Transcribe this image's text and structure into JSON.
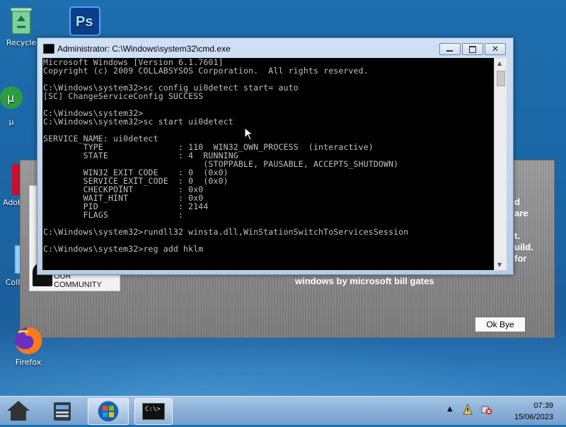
{
  "desktop": {
    "icons": [
      {
        "label": "Recycle",
        "icon": "recycle-bin-icon"
      },
      {
        "label": "",
        "icon": "photoshop-icon"
      },
      {
        "label": "Firefox",
        "icon": "firefox-icon"
      },
      {
        "label": "Adob",
        "icon": "adobe-icon"
      },
      {
        "label": "Coll",
        "icon": "collab-icon"
      },
      {
        "label": "µ",
        "icon": "utorrent-icon"
      }
    ]
  },
  "bg_dialog": {
    "right_text_1": "d",
    "right_text_2": "are",
    "right_text_3": "t.",
    "right_text_4": "uild.",
    "right_text_5": "for",
    "bottom_text": "windows by microsoft bill gates",
    "left_partial": "OUR COMMUNITY",
    "ok_button": "Ok Bye"
  },
  "cmd_window": {
    "title": "Administrator: C:\\Windows\\system32\\cmd.exe",
    "lines": [
      "Microsoft Windows [Version 6.1.7601]",
      "Copyright (c) 2009 COLLABSYSOS Corporation.  All rights reserved.",
      "",
      "C:\\Windows\\system32>sc config ui0detect start= auto",
      "[SC] ChangeServiceConfig SUCCESS",
      "",
      "C:\\Windows\\system32>",
      "C:\\Windows\\system32>sc start ui0detect",
      "",
      "SERVICE_NAME: ui0detect",
      "        TYPE               : 110  WIN32_OWN_PROCESS  (interactive)",
      "        STATE              : 4  RUNNING",
      "                                (STOPPABLE, PAUSABLE, ACCEPTS_SHUTDOWN)",
      "        WIN32_EXIT_CODE    : 0  (0x0)",
      "        SERVICE_EXIT_CODE  : 0  (0x0)",
      "        CHECKPOINT         : 0x0",
      "        WAIT_HINT          : 0x0",
      "        PID                : 2144",
      "        FLAGS              :",
      "",
      "C:\\Windows\\system32>rundll32 winsta.dll,WinStationSwitchToServicesSession",
      "",
      "C:\\Windows\\system32>reg add hklm"
    ]
  },
  "taskbar": {
    "buttons": [
      "home-icon",
      "file-manager-icon",
      "start-orb-icon",
      "cmd-icon"
    ],
    "active_task": "C:\\>",
    "time": "07:39",
    "date": "15/06/2023"
  },
  "colors": {
    "desktop_bg": "#1e6fae",
    "console_bg": "#000000",
    "console_fg": "#c0c0c0"
  }
}
